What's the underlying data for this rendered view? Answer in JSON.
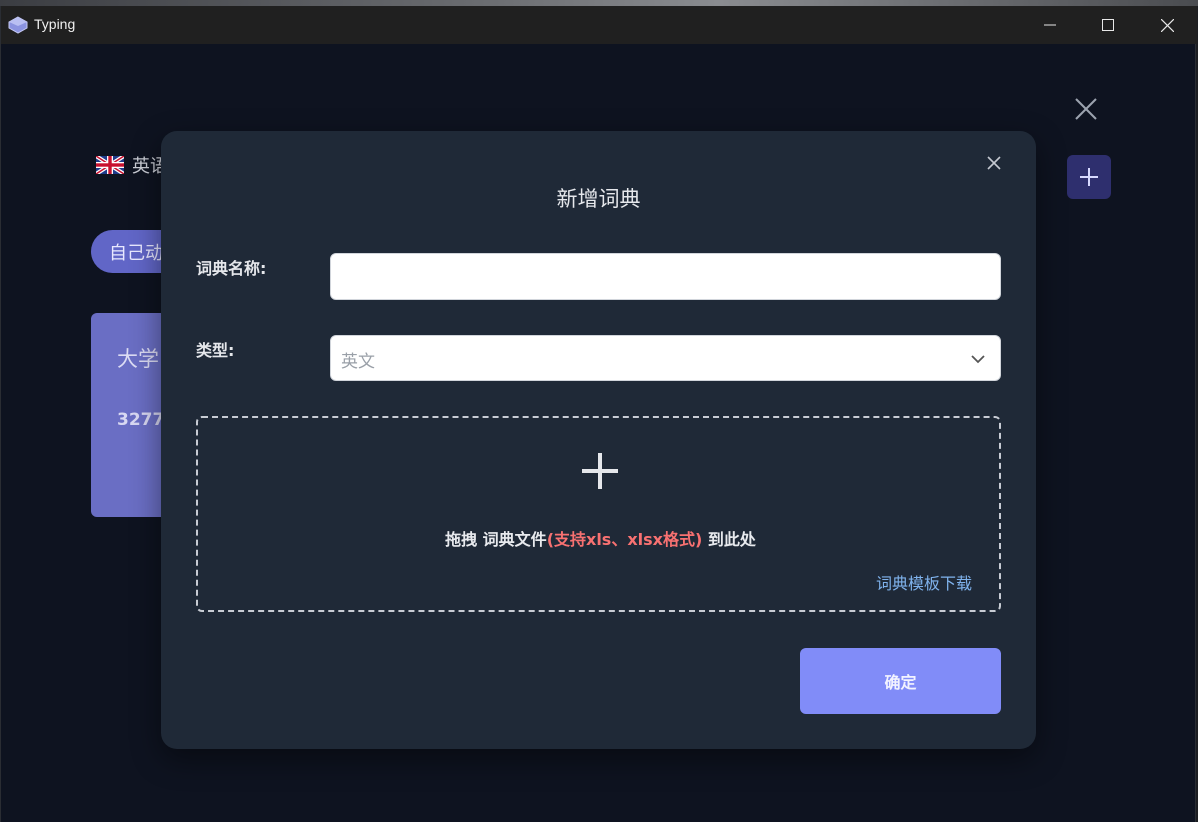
{
  "window": {
    "title": "Typing"
  },
  "background": {
    "language_label": "英语",
    "pill_label": "自己动",
    "card_title": "大学",
    "card_count": "3277"
  },
  "modal": {
    "title": "新增词典",
    "name_label": "词典名称:",
    "name_value": "",
    "type_label": "类型:",
    "type_value": "英文",
    "drop_text_prefix": "拖拽 词典文件",
    "drop_text_highlight": "(支持xls、xlsx格式)",
    "drop_text_suffix": " 到此处",
    "template_link": "词典模板下载",
    "confirm_label": "确定"
  },
  "icons": {
    "app": "typing-app-icon",
    "minimize": "minimize-icon",
    "maximize": "maximize-icon",
    "close": "close-icon",
    "flag": "uk-flag-icon",
    "add": "plus-icon",
    "chevron": "chevron-down-icon"
  },
  "colors": {
    "modal_bg": "#1f2937",
    "accent": "#818cf8",
    "highlight": "#f87171",
    "link": "#7fb2ec"
  }
}
